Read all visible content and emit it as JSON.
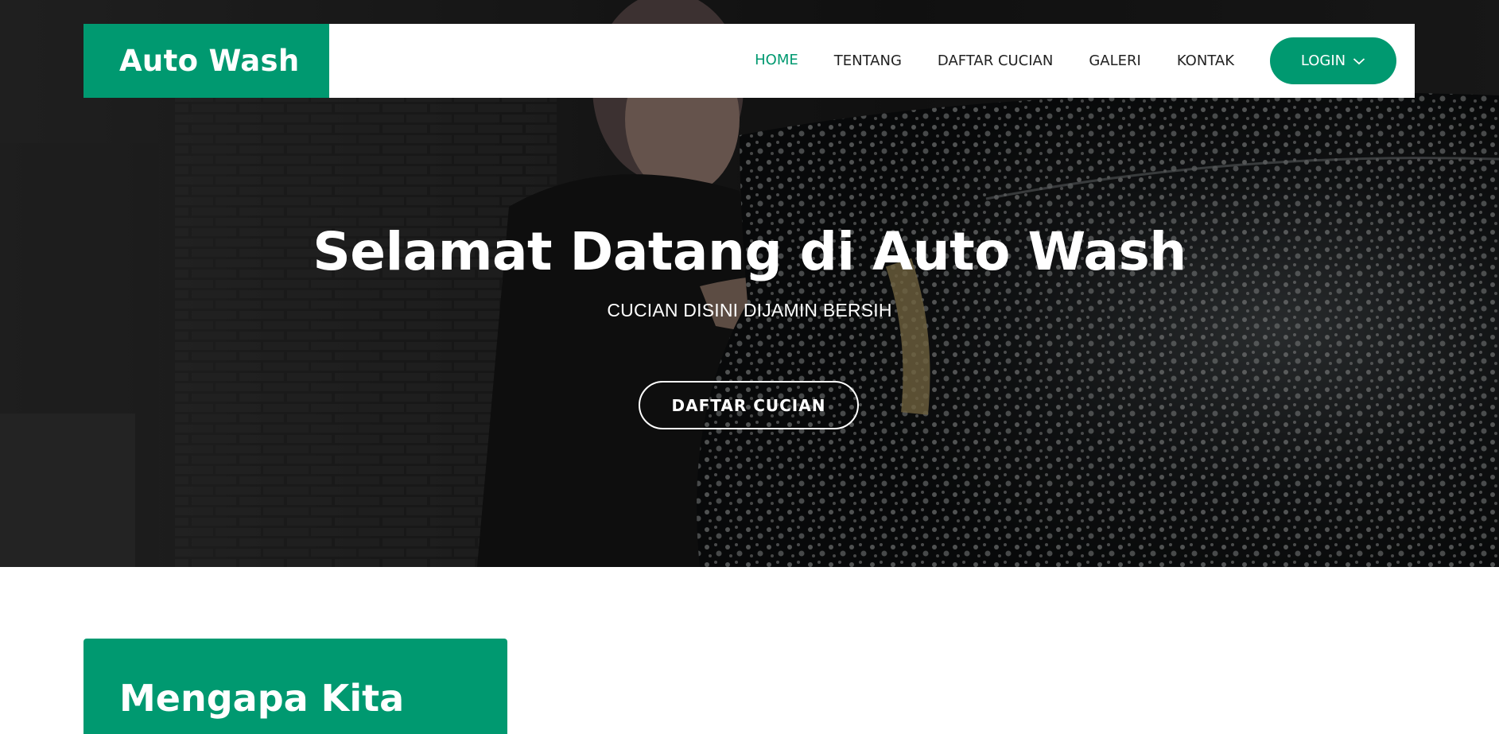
{
  "brand": {
    "name": "Auto Wash",
    "accent": "#009970"
  },
  "nav": {
    "items": [
      {
        "label": "HOME",
        "active": true
      },
      {
        "label": "TENTANG"
      },
      {
        "label": "DAFTAR CUCIAN"
      },
      {
        "label": "GALERI"
      },
      {
        "label": "KONTAK"
      }
    ],
    "login_label": "LOGIN",
    "login_icon": "chevron-down-icon"
  },
  "hero": {
    "title": "Selamat Datang di Auto Wash",
    "subtitle": "CUCIAN DISINI DIJAMIN BERSIH",
    "cta_label": "DAFTAR CUCIAN"
  },
  "why": {
    "title": "Mengapa Kita"
  }
}
